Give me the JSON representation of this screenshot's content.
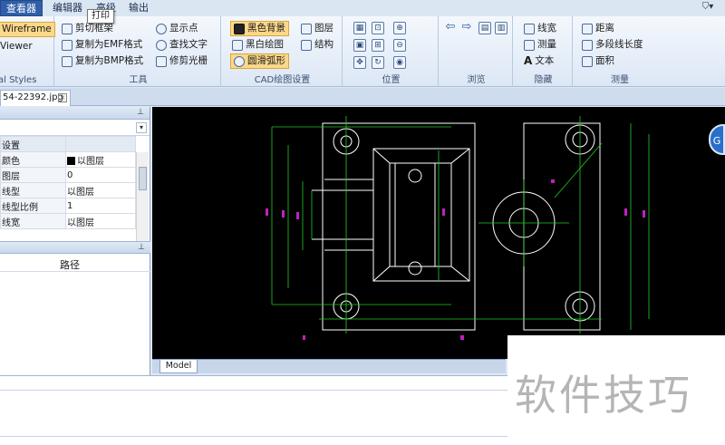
{
  "menu": {
    "tabs": [
      "查看器",
      "编辑器",
      "高级",
      "输出"
    ],
    "tooltip": "打印"
  },
  "ribbon": {
    "left_group": {
      "items": [
        "Wireframe",
        "Viewer",
        "al Styles"
      ]
    },
    "tools": {
      "label": "工具",
      "items": [
        "剪切框架",
        "复制为EMF格式",
        "复制为BMP格式",
        "显示点",
        "查找文字",
        "修剪光栅"
      ]
    },
    "cad_settings": {
      "label": "CAD绘图设置",
      "items": [
        "黑色背景",
        "黑白绘图",
        "圆滑弧形",
        "图层",
        "结构"
      ]
    },
    "position": {
      "label": "位置"
    },
    "browse": {
      "label": "浏览"
    },
    "hide": {
      "label": "隐藏",
      "items": [
        "线宽",
        "测量",
        "文本"
      ]
    },
    "measure": {
      "label": "测量",
      "items": [
        "距离",
        "多段线长度",
        "面积"
      ]
    }
  },
  "document": {
    "tab_name": "54-22392.jpg"
  },
  "properties": {
    "rows": [
      {
        "key": "设置",
        "value": ""
      },
      {
        "key": "颜色",
        "value": "以图层"
      },
      {
        "key": "图层",
        "value": "0"
      },
      {
        "key": "线型",
        "value": "以图层"
      },
      {
        "key": "线型比例",
        "value": "1"
      },
      {
        "key": "线宽",
        "value": "以图层"
      }
    ],
    "path_header": "路径"
  },
  "drawing": {
    "model_tab": "Model",
    "bg_color": "#000000",
    "line_color": "#ffffff",
    "dim_color": "#22cc22",
    "text_color": "#c020c0"
  },
  "watermark": {
    "text": "软件技巧"
  },
  "float_button": {
    "label": "G"
  }
}
